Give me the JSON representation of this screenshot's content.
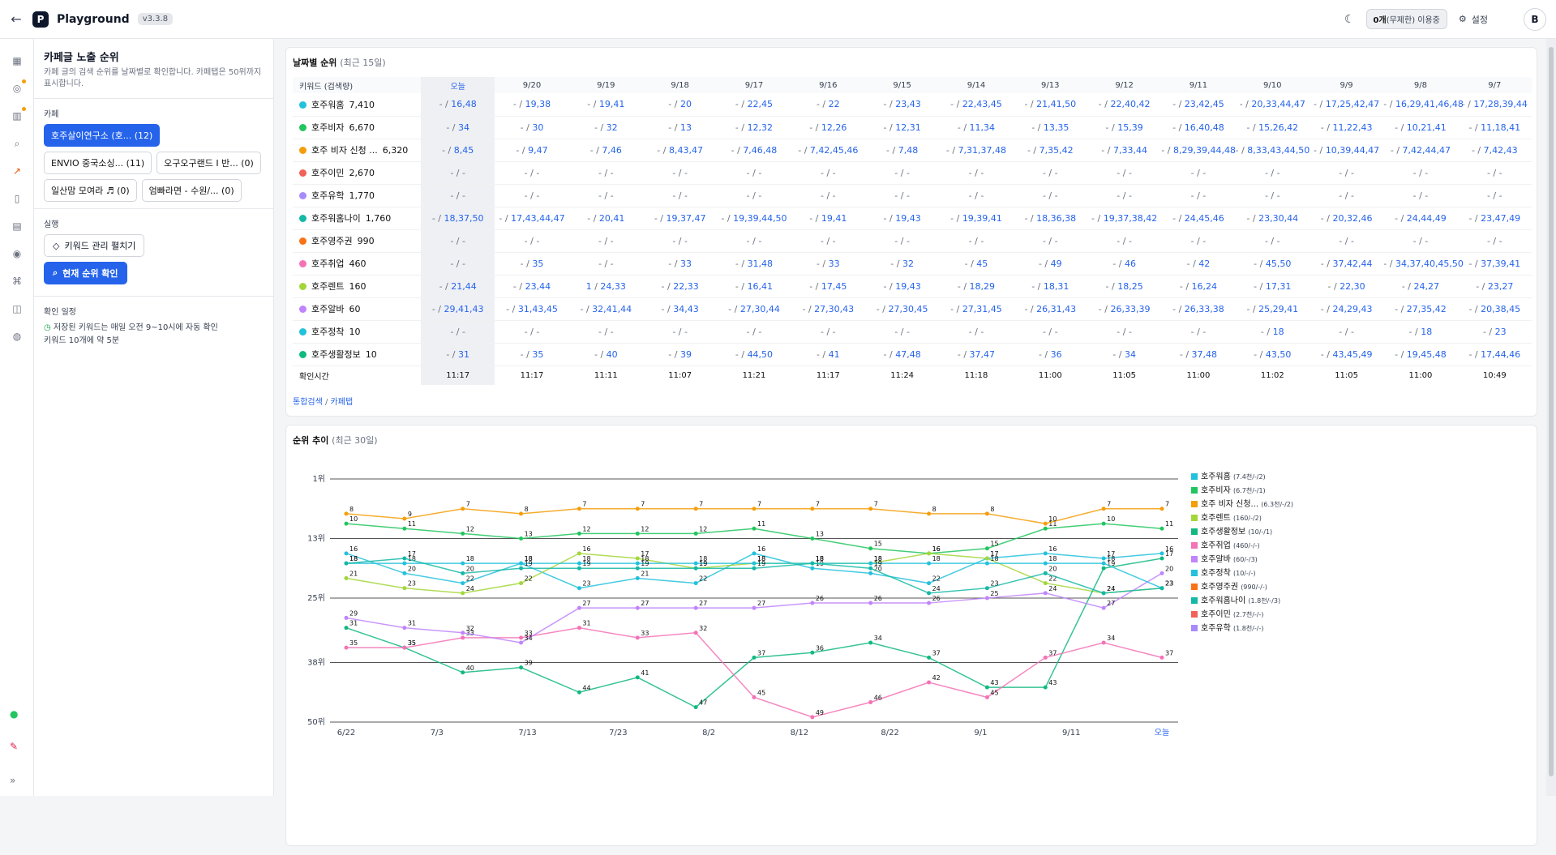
{
  "app": {
    "name": "Playground",
    "version": "v3.3.8",
    "usage_count": "0개",
    "usage_rest": "(무제한) 이용중",
    "settings": "설정",
    "avatar": "B"
  },
  "sidebar": {
    "title": "카페글 노출 순위",
    "desc": "카페 글의 검색 순위를 날짜별로 확인합니다. 카페탭은 50위까지 표시합니다.",
    "cafe_label": "카페",
    "cafes": [
      {
        "label": "호주살이연구소 (호... (12)",
        "active": true
      },
      {
        "label": "ENVIO 중국소싱... (11)",
        "active": false
      },
      {
        "label": "오구오구랜드 I 반... (0)",
        "active": false
      },
      {
        "label": "일산맘 모여라 ♬ (0)",
        "active": false
      },
      {
        "label": "엄빠라면 - 수원/... (0)",
        "active": false
      }
    ],
    "run_label": "실행",
    "btn_keywords": "키워드 관리  펼치기",
    "btn_check": "현재 순위 확인",
    "sched_label": "확인 일정",
    "sched_text": "저장된 키워드는 매일 오전 9~10시에 자동 확인",
    "sched_eta": "키워드 10개에 약 5분"
  },
  "daily": {
    "title": "날짜별 순위",
    "subtitle": "(최근 15일)",
    "kw_header": "키워드 (검색량)",
    "dates": [
      "오늘",
      "9/20",
      "9/19",
      "9/18",
      "9/17",
      "9/16",
      "9/15",
      "9/14",
      "9/13",
      "9/12",
      "9/11",
      "9/10",
      "9/9",
      "9/8",
      "9/7"
    ],
    "rows": [
      {
        "kw": "호주워홈",
        "vol": "7,410",
        "color": "#22c1dc",
        "cells": [
          "16,48",
          "19,38",
          "19,41",
          "20",
          "22,45",
          "22",
          "23,43",
          "22,43,45",
          "21,41,50",
          "22,40,42",
          "23,42,45",
          "20,33,44,47",
          "17,25,42,47",
          "16,29,41,46,48",
          "17,28,39,44"
        ]
      },
      {
        "kw": "호주비자",
        "vol": "6,670",
        "color": "#22c55e",
        "cells": [
          "34",
          "30",
          "32",
          "13",
          "12,32",
          "12,26",
          "12,31",
          "11,34",
          "13,35",
          "15,39",
          "16,40,48",
          "15,26,42",
          "11,22,43",
          "10,21,41",
          "11,18,41"
        ]
      },
      {
        "kw": "호주 비자 신청 ...",
        "vol": "6,320",
        "color": "#f59e0b",
        "cells": [
          "8,45",
          "9,47",
          "7,46",
          "8,43,47",
          "7,46,48",
          "7,42,45,46",
          "7,48",
          "7,31,37,48",
          "7,35,42",
          "7,33,44",
          "8,29,39,44,48",
          "8,33,43,44,50",
          "10,39,44,47",
          "7,42,44,47",
          "7,42,43"
        ]
      },
      {
        "kw": "호주이민",
        "vol": "2,670",
        "color": "#f0625a",
        "cells": [
          "",
          "",
          "",
          "",
          "",
          "",
          "",
          "",
          "",
          "",
          "",
          "",
          "",
          "",
          ""
        ]
      },
      {
        "kw": "호주유학",
        "vol": "1,770",
        "color": "#a78bfa",
        "cells": [
          "",
          "",
          "",
          "",
          "",
          "",
          "",
          "",
          "",
          "",
          "",
          "",
          "",
          "",
          ""
        ]
      },
      {
        "kw": "호주워홈나이",
        "vol": "1,760",
        "color": "#14b8a6",
        "cells": [
          "18,37,50",
          "17,43,44,47",
          "20,41",
          "19,37,47",
          "19,39,44,50",
          "19,41",
          "19,43",
          "19,39,41",
          "18,36,38",
          "19,37,38,42",
          "24,45,46",
          "23,30,44",
          "20,32,46",
          "24,44,49",
          "23,47,49"
        ]
      },
      {
        "kw": "호주영주권",
        "vol": "990",
        "color": "#f97316",
        "cells": [
          "",
          "",
          "",
          "",
          "",
          "",
          "",
          "",
          "",
          "",
          "",
          "",
          "",
          "",
          ""
        ]
      },
      {
        "kw": "호주취업",
        "vol": "460",
        "color": "#f472b6",
        "cells": [
          "",
          "35",
          "",
          "33",
          "31,48",
          "33",
          "32",
          "45",
          "49",
          "46",
          "42",
          "45,50",
          "37,42,44",
          "34,37,40,45,50",
          "37,39,41"
        ]
      },
      {
        "kw": "호주렌트",
        "vol": "160",
        "color": "#a3d63a",
        "cells": [
          "21,44",
          "23,44",
          "1|24,33",
          "22,33",
          "16,41",
          "17,45",
          "19,43",
          "18,29",
          "18,31",
          "18,25",
          "16,24",
          "17,31",
          "22,30",
          "24,27",
          "23,27"
        ]
      },
      {
        "kw": "호주알바",
        "vol": "60",
        "color": "#c084fc",
        "cells": [
          "29,41,43",
          "31,43,45",
          "32,41,44",
          "34,43",
          "27,30,44",
          "27,30,43",
          "27,30,45",
          "27,31,45",
          "26,31,43",
          "26,33,39",
          "26,33,38",
          "25,29,41",
          "24,29,43",
          "27,35,42",
          "20,38,45"
        ]
      },
      {
        "kw": "호주정착",
        "vol": "10",
        "color": "#22c1dc",
        "cells": [
          "",
          "",
          "",
          "",
          "",
          "",
          "",
          "",
          "",
          "",
          "",
          "18",
          "",
          "18",
          "23"
        ]
      },
      {
        "kw": "호주생활정보",
        "vol": "10",
        "color": "#10b981",
        "cells": [
          "31",
          "35",
          "40",
          "39",
          "44,50",
          "41",
          "47,48",
          "37,47",
          "36",
          "34",
          "37,48",
          "43,50",
          "43,45,49",
          "19,45,48",
          "17,44,46"
        ]
      }
    ],
    "time_label": "확인시간",
    "times": [
      "11:17",
      "11:17",
      "11:11",
      "11:07",
      "11:21",
      "11:17",
      "11:24",
      "11:18",
      "11:00",
      "11:05",
      "11:00",
      "11:02",
      "11:05",
      "11:00",
      "10:49"
    ],
    "foot_a": "통합검색",
    "foot_sep": " / ",
    "foot_b": "카페탭"
  },
  "trend": {
    "title": "순위 추이",
    "subtitle": "(최근 30일)",
    "chart_data": {
      "type": "line",
      "y_reversed": true,
      "ylim": [
        1,
        50
      ],
      "yticks": [
        "1위",
        "13위",
        "25위",
        "38위",
        "50위"
      ],
      "x_ticks": [
        "6/22",
        "7/3",
        "7/13",
        "7/23",
        "8/2",
        "8/12",
        "8/22",
        "9/1",
        "9/11",
        "오늘"
      ],
      "legend_position": "right",
      "series": [
        {
          "name": "호주워홈",
          "extra": "(7.4천/-/2)",
          "color": "#22c1dc",
          "values": [
            16,
            20,
            22,
            18,
            23,
            21,
            22,
            16,
            19,
            20,
            22,
            17,
            16,
            17,
            16
          ]
        },
        {
          "name": "호주비자",
          "extra": "(6.7천/-/1)",
          "color": "#22c55e",
          "values": [
            10,
            11,
            12,
            13,
            12,
            12,
            12,
            11,
            13,
            15,
            16,
            15,
            11,
            10,
            11
          ]
        },
        {
          "name": "호주 비자 신청...",
          "extra": "(6.3천/-/2)",
          "color": "#f59e0b",
          "values": [
            8,
            9,
            7,
            8,
            7,
            7,
            7,
            7,
            7,
            7,
            8,
            8,
            10,
            7,
            7
          ]
        },
        {
          "name": "호주렌트",
          "extra": "(160/-/2)",
          "color": "#a3d63a",
          "values": [
            21,
            23,
            24,
            22,
            16,
            17,
            19,
            18,
            18,
            18,
            16,
            17,
            22,
            24,
            23
          ]
        },
        {
          "name": "호주생활정보",
          "extra": "(10/-/1)",
          "color": "#10b981",
          "values": [
            31,
            35,
            40,
            39,
            44,
            41,
            47,
            37,
            36,
            34,
            37,
            43,
            43,
            19,
            17
          ]
        },
        {
          "name": "호주취업",
          "extra": "(460/-/-)",
          "color": "#f472b6",
          "values": [
            35,
            35,
            33,
            33,
            31,
            33,
            32,
            45,
            49,
            46,
            42,
            45,
            37,
            34,
            37
          ]
        },
        {
          "name": "호주알바",
          "extra": "(60/-/3)",
          "color": "#c084fc",
          "values": [
            29,
            31,
            32,
            34,
            27,
            27,
            27,
            27,
            26,
            26,
            26,
            25,
            24,
            27,
            20
          ]
        },
        {
          "name": "호주정착",
          "extra": "(10/-/-)",
          "color": "#22c1dc",
          "values": [
            18,
            18,
            18,
            18,
            18,
            18,
            18,
            18,
            18,
            18,
            18,
            18,
            18,
            18,
            23
          ]
        },
        {
          "name": "호주영주권",
          "extra": "(990/-/-)",
          "color": "#f97316",
          "values": []
        },
        {
          "name": "호주워홈나이",
          "extra": "(1.8천/-/3)",
          "color": "#14b8a6",
          "values": [
            18,
            17,
            20,
            19,
            19,
            19,
            19,
            19,
            18,
            19,
            24,
            23,
            20,
            24,
            23
          ]
        },
        {
          "name": "호주이민",
          "extra": "(2.7천/-/-)",
          "color": "#f0625a",
          "values": []
        },
        {
          "name": "호주유학",
          "extra": "(1.8천/-/-)",
          "color": "#a78bfa",
          "values": []
        }
      ]
    }
  }
}
